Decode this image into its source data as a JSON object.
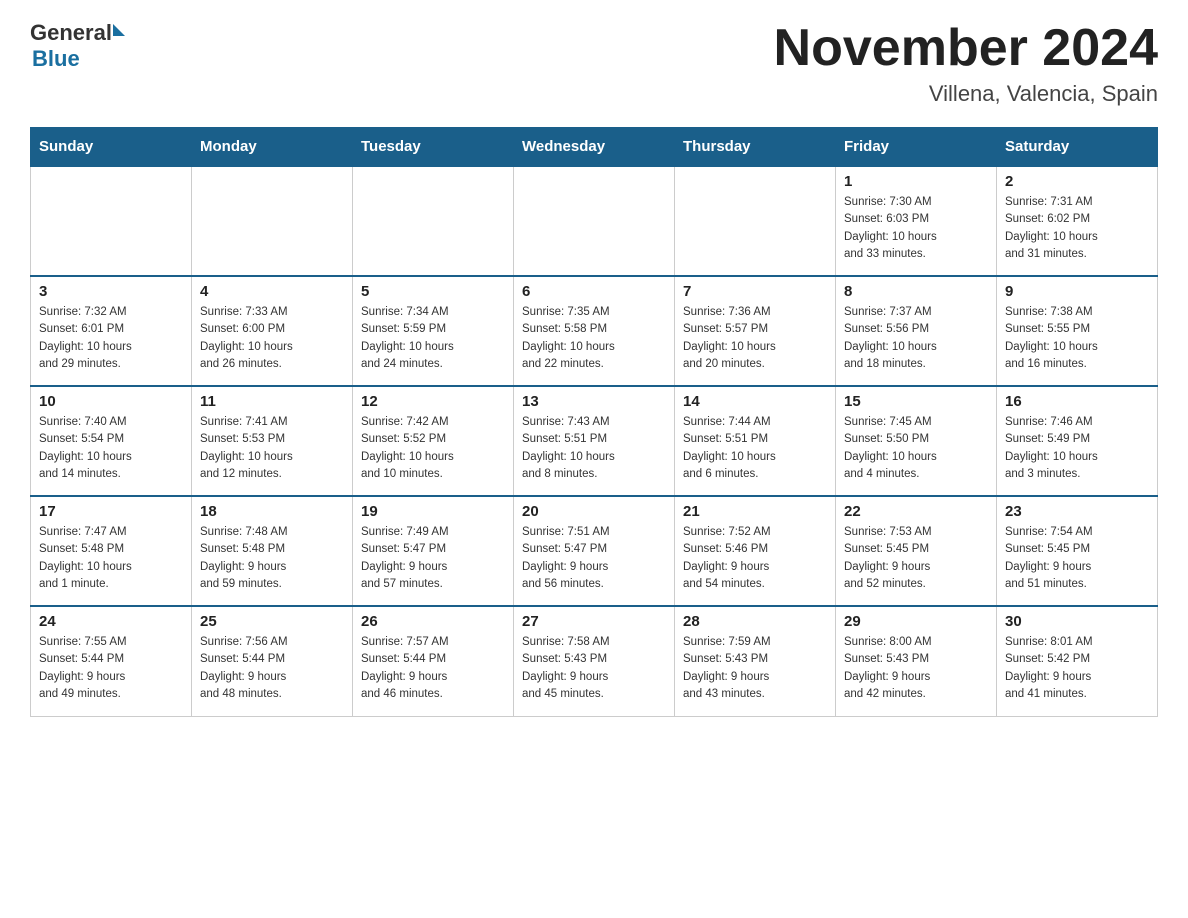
{
  "header": {
    "logo_general": "General",
    "logo_blue": "Blue",
    "month_title": "November 2024",
    "subtitle": "Villena, Valencia, Spain"
  },
  "days_of_week": [
    "Sunday",
    "Monday",
    "Tuesday",
    "Wednesday",
    "Thursday",
    "Friday",
    "Saturday"
  ],
  "weeks": [
    {
      "cells": [
        {
          "day": "",
          "info": ""
        },
        {
          "day": "",
          "info": ""
        },
        {
          "day": "",
          "info": ""
        },
        {
          "day": "",
          "info": ""
        },
        {
          "day": "",
          "info": ""
        },
        {
          "day": "1",
          "info": "Sunrise: 7:30 AM\nSunset: 6:03 PM\nDaylight: 10 hours\nand 33 minutes."
        },
        {
          "day": "2",
          "info": "Sunrise: 7:31 AM\nSunset: 6:02 PM\nDaylight: 10 hours\nand 31 minutes."
        }
      ]
    },
    {
      "cells": [
        {
          "day": "3",
          "info": "Sunrise: 7:32 AM\nSunset: 6:01 PM\nDaylight: 10 hours\nand 29 minutes."
        },
        {
          "day": "4",
          "info": "Sunrise: 7:33 AM\nSunset: 6:00 PM\nDaylight: 10 hours\nand 26 minutes."
        },
        {
          "day": "5",
          "info": "Sunrise: 7:34 AM\nSunset: 5:59 PM\nDaylight: 10 hours\nand 24 minutes."
        },
        {
          "day": "6",
          "info": "Sunrise: 7:35 AM\nSunset: 5:58 PM\nDaylight: 10 hours\nand 22 minutes."
        },
        {
          "day": "7",
          "info": "Sunrise: 7:36 AM\nSunset: 5:57 PM\nDaylight: 10 hours\nand 20 minutes."
        },
        {
          "day": "8",
          "info": "Sunrise: 7:37 AM\nSunset: 5:56 PM\nDaylight: 10 hours\nand 18 minutes."
        },
        {
          "day": "9",
          "info": "Sunrise: 7:38 AM\nSunset: 5:55 PM\nDaylight: 10 hours\nand 16 minutes."
        }
      ]
    },
    {
      "cells": [
        {
          "day": "10",
          "info": "Sunrise: 7:40 AM\nSunset: 5:54 PM\nDaylight: 10 hours\nand 14 minutes."
        },
        {
          "day": "11",
          "info": "Sunrise: 7:41 AM\nSunset: 5:53 PM\nDaylight: 10 hours\nand 12 minutes."
        },
        {
          "day": "12",
          "info": "Sunrise: 7:42 AM\nSunset: 5:52 PM\nDaylight: 10 hours\nand 10 minutes."
        },
        {
          "day": "13",
          "info": "Sunrise: 7:43 AM\nSunset: 5:51 PM\nDaylight: 10 hours\nand 8 minutes."
        },
        {
          "day": "14",
          "info": "Sunrise: 7:44 AM\nSunset: 5:51 PM\nDaylight: 10 hours\nand 6 minutes."
        },
        {
          "day": "15",
          "info": "Sunrise: 7:45 AM\nSunset: 5:50 PM\nDaylight: 10 hours\nand 4 minutes."
        },
        {
          "day": "16",
          "info": "Sunrise: 7:46 AM\nSunset: 5:49 PM\nDaylight: 10 hours\nand 3 minutes."
        }
      ]
    },
    {
      "cells": [
        {
          "day": "17",
          "info": "Sunrise: 7:47 AM\nSunset: 5:48 PM\nDaylight: 10 hours\nand 1 minute."
        },
        {
          "day": "18",
          "info": "Sunrise: 7:48 AM\nSunset: 5:48 PM\nDaylight: 9 hours\nand 59 minutes."
        },
        {
          "day": "19",
          "info": "Sunrise: 7:49 AM\nSunset: 5:47 PM\nDaylight: 9 hours\nand 57 minutes."
        },
        {
          "day": "20",
          "info": "Sunrise: 7:51 AM\nSunset: 5:47 PM\nDaylight: 9 hours\nand 56 minutes."
        },
        {
          "day": "21",
          "info": "Sunrise: 7:52 AM\nSunset: 5:46 PM\nDaylight: 9 hours\nand 54 minutes."
        },
        {
          "day": "22",
          "info": "Sunrise: 7:53 AM\nSunset: 5:45 PM\nDaylight: 9 hours\nand 52 minutes."
        },
        {
          "day": "23",
          "info": "Sunrise: 7:54 AM\nSunset: 5:45 PM\nDaylight: 9 hours\nand 51 minutes."
        }
      ]
    },
    {
      "cells": [
        {
          "day": "24",
          "info": "Sunrise: 7:55 AM\nSunset: 5:44 PM\nDaylight: 9 hours\nand 49 minutes."
        },
        {
          "day": "25",
          "info": "Sunrise: 7:56 AM\nSunset: 5:44 PM\nDaylight: 9 hours\nand 48 minutes."
        },
        {
          "day": "26",
          "info": "Sunrise: 7:57 AM\nSunset: 5:44 PM\nDaylight: 9 hours\nand 46 minutes."
        },
        {
          "day": "27",
          "info": "Sunrise: 7:58 AM\nSunset: 5:43 PM\nDaylight: 9 hours\nand 45 minutes."
        },
        {
          "day": "28",
          "info": "Sunrise: 7:59 AM\nSunset: 5:43 PM\nDaylight: 9 hours\nand 43 minutes."
        },
        {
          "day": "29",
          "info": "Sunrise: 8:00 AM\nSunset: 5:43 PM\nDaylight: 9 hours\nand 42 minutes."
        },
        {
          "day": "30",
          "info": "Sunrise: 8:01 AM\nSunset: 5:42 PM\nDaylight: 9 hours\nand 41 minutes."
        }
      ]
    }
  ]
}
